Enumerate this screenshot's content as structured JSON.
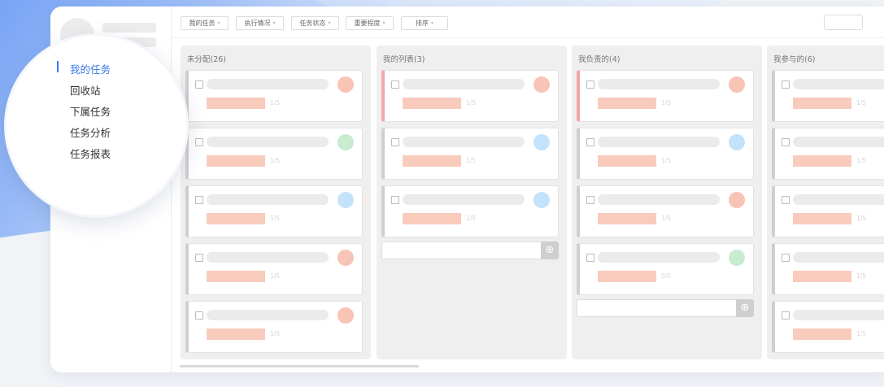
{
  "filters": [
    {
      "label": "我的任务"
    },
    {
      "label": "执行情况"
    },
    {
      "label": "任务状态"
    },
    {
      "label": "重要程度"
    },
    {
      "label": "排序"
    }
  ],
  "menu": [
    {
      "label": "我的任务",
      "active": true
    },
    {
      "label": "回收站"
    },
    {
      "label": "下属任务"
    },
    {
      "label": "任务分析"
    },
    {
      "label": "任务报表"
    }
  ],
  "columns": [
    {
      "title": "未分配(26)",
      "cards": [
        {
          "dot": "#f8c4b6",
          "sub": "1/5"
        },
        {
          "dot": "#c8ecd0",
          "sub": "1/5"
        },
        {
          "dot": "#c3e3fb",
          "sub": "1/5"
        },
        {
          "dot": "#f8c4b6",
          "sub": "1/5"
        },
        {
          "dot": "#f8c4b6",
          "sub": "1/5"
        }
      ]
    },
    {
      "title": "我的列表(3)",
      "cards": [
        {
          "dot": "#f8c4b6",
          "sub": "1/5",
          "accent": "red"
        },
        {
          "dot": "#c3e3fb",
          "sub": "1/5"
        },
        {
          "dot": "#c3e3fb",
          "sub": "1/5"
        }
      ]
    },
    {
      "title": "我负责的(4)",
      "cards": [
        {
          "dot": "#f8c4b6",
          "sub": "1/5",
          "accent": "red"
        },
        {
          "dot": "#c3e3fb",
          "sub": "1/5"
        },
        {
          "dot": "#f8c4b6",
          "sub": "1/5"
        },
        {
          "dot": "#c8ecd0",
          "sub": "0/0"
        }
      ]
    },
    {
      "title": "我参与的(6)",
      "cards": [
        {
          "dot": "",
          "sub": "1/5"
        },
        {
          "dot": "",
          "sub": "1/5"
        },
        {
          "dot": "",
          "sub": "1/5"
        },
        {
          "dot": "",
          "sub": "1/5"
        },
        {
          "dot": "",
          "sub": "1/5"
        }
      ]
    }
  ],
  "add_icon": "⊕"
}
